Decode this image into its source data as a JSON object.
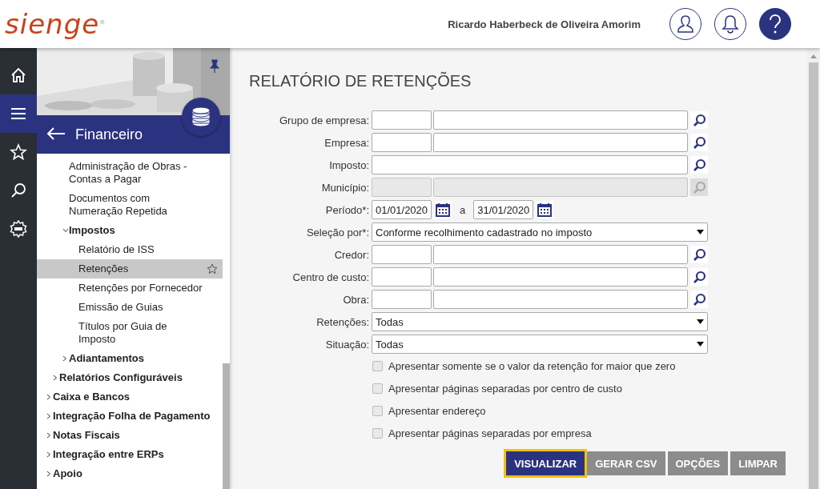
{
  "header": {
    "logo": "sienge$^{®}$",
    "user_name": "Ricardo Haberbeck de Oliveira Amorim"
  },
  "rail": [
    {
      "kind": "home",
      "selected": false
    },
    {
      "kind": "menu",
      "selected": true
    },
    {
      "kind": "favorites",
      "selected": false
    },
    {
      "kind": "search",
      "selected": false
    },
    {
      "kind": "new",
      "selected": false
    }
  ],
  "sidebar": {
    "title": "Financeiro",
    "menu": [
      {
        "children": [
          {
            "children": [
              {
                "label": "Administração de Obras - Contas a Pagar",
                "selected": false
              },
              {
                "label": "Documentos com Numeração Repetida",
                "selected": false
              },
              {
                "label": "Impostos",
                "expanded": true,
                "selected": false,
                "children": [
                  {
                    "label": "Relatório de ISS",
                    "selected": false
                  },
                  {
                    "label": "Retenções",
                    "selected": true
                  },
                  {
                    "label": "Retenções por Fornecedor",
                    "selected": false
                  },
                  {
                    "label": "Emissão de Guias",
                    "selected": false
                  },
                  {
                    "label": "Títulos por Guia de Imposto",
                    "selected": false
                  }
                ]
              },
              {
                "label": "Adiantamentos",
                "expanded": false,
                "selected": false
              }
            ]
          },
          {
            "label": "Relatórios Configuráveis",
            "expanded": false,
            "selected": false
          }
        ]
      },
      {
        "label": "Caixa e Bancos",
        "expanded": false,
        "selected": false
      },
      {
        "label": "Integração Folha de Pagamento",
        "expanded": false,
        "selected": false
      },
      {
        "label": "Notas Fiscais",
        "expanded": false,
        "selected": false
      },
      {
        "label": "Integração entre ERPs",
        "expanded": false,
        "selected": false
      },
      {
        "label": "Apoio",
        "expanded": false,
        "selected": false
      }
    ]
  },
  "page": {
    "title": "RELATÓRIO DE RETENÇÕES",
    "fields": [
      {
        "kind": "lookup",
        "label": "Grupo de empresa:",
        "disabled": false
      },
      {
        "kind": "lookup",
        "label": "Empresa:",
        "disabled": false
      },
      {
        "kind": "single",
        "label": "Imposto:",
        "disabled": false
      },
      {
        "kind": "lookup",
        "label": "Município:",
        "disabled": true
      },
      {
        "kind": "dates",
        "label": "Período*:",
        "from": "01/01/2020",
        "separator": "a",
        "to": "31/01/2020"
      },
      {
        "kind": "select",
        "label": "Seleção por*:",
        "value": "Conforme recolhimento cadastrado no imposto"
      },
      {
        "kind": "lookup",
        "label": "Credor:",
        "disabled": false
      },
      {
        "kind": "lookup",
        "label": "Centro de custo:",
        "disabled": false
      },
      {
        "kind": "lookup",
        "label": "Obra:",
        "disabled": false
      },
      {
        "kind": "select",
        "label": "Retenções:",
        "value": "Todas"
      },
      {
        "kind": "select",
        "label": "Situação:",
        "value": "Todas"
      }
    ],
    "options": [
      {
        "label": "Apresentar somente se o valor da retenção for maior que zero",
        "checked": false
      },
      {
        "label": "Apresentar páginas separadas por centro de custo",
        "checked": false
      },
      {
        "label": "Apresentar endereço",
        "checked": false
      },
      {
        "label": "Apresentar páginas separadas por empresa",
        "checked": false
      }
    ],
    "buttons": [
      {
        "label": "VISUALIZAR",
        "kind": "primary",
        "focused": true
      },
      {
        "label": "GERAR CSV",
        "kind": "secondary",
        "focused": false
      },
      {
        "label": "OPÇÕES",
        "kind": "secondary",
        "focused": false
      },
      {
        "label": "LIMPAR",
        "kind": "secondary",
        "focused": false
      }
    ]
  }
}
